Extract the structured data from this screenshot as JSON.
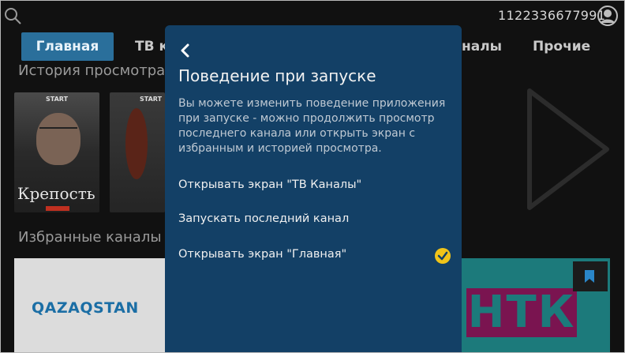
{
  "header": {
    "account_id": "1122336677991",
    "icons": {
      "search": "search-icon",
      "avatar": "avatar-icon"
    }
  },
  "tabs": [
    {
      "label": "Главная",
      "active": true
    },
    {
      "label": "ТВ к",
      "active": false
    },
    {
      "label": "налы",
      "active": false
    },
    {
      "label": "Прочие",
      "active": false
    }
  ],
  "sections": {
    "history_title": "История просмотра",
    "favorites_title": "Избранные каналы"
  },
  "posters": [
    {
      "badge": "START",
      "title": "Крепость"
    },
    {
      "badge": "START",
      "title": ""
    }
  ],
  "channels": [
    {
      "logo_text": "QAZAQSTAN"
    },
    {
      "logo_text": "НТК"
    }
  ],
  "dialog": {
    "title": "Поведение при запуске",
    "description": "Вы можете изменить поведение приложения при запуске - можно продолжить просмотр последнего канала или открыть экран с избранным и историей просмотра.",
    "options": [
      {
        "label": "Открывать экран \"ТВ Каналы\"",
        "selected": false
      },
      {
        "label": "Запускать последний канал",
        "selected": false
      },
      {
        "label": "Открывать экран \"Главная\"",
        "selected": true
      }
    ]
  },
  "colors": {
    "dialog_bg": "#134066",
    "active_tab": "#2a6f9b",
    "check": "#f0c419"
  }
}
